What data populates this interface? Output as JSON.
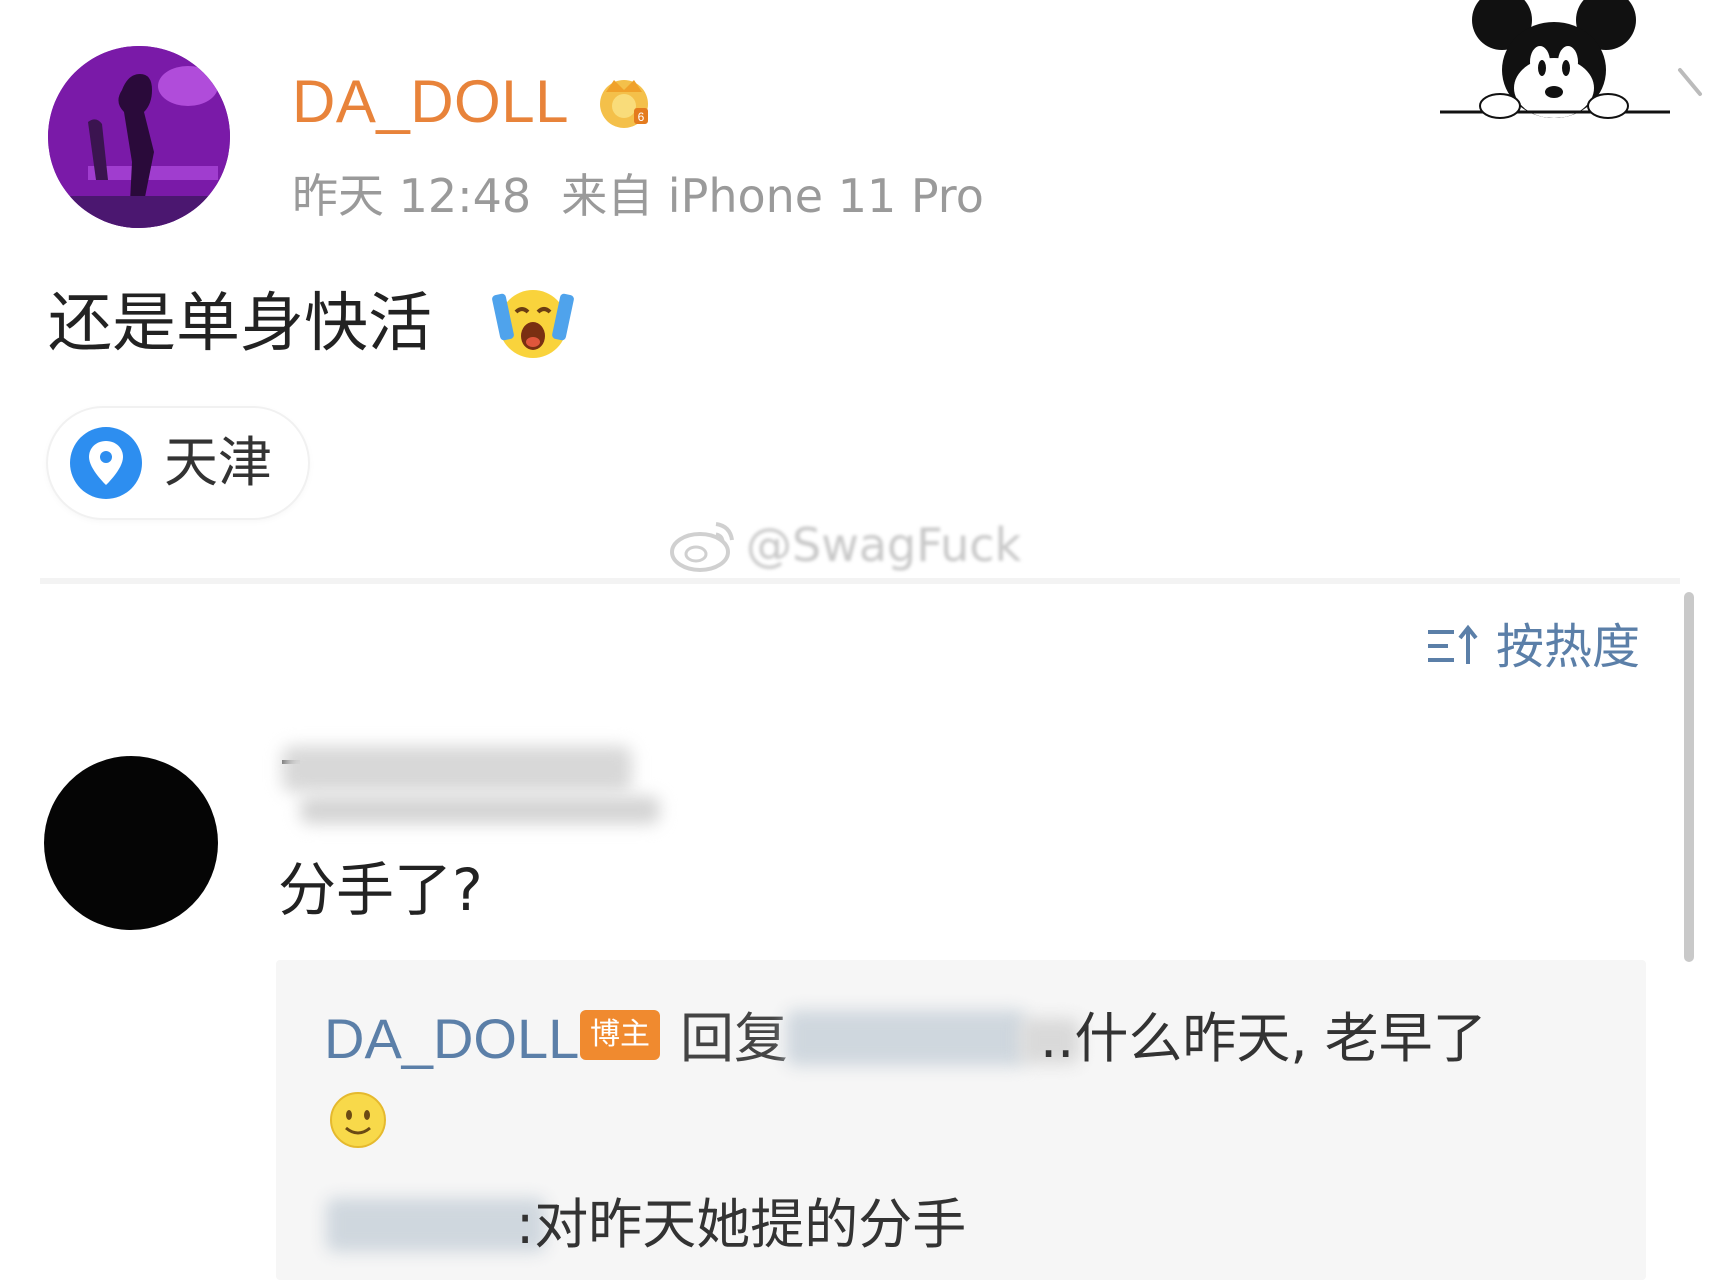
{
  "post": {
    "username": "DA_DOLL",
    "time": "昨天 12:48",
    "source": "来自 iPhone 11 Pro",
    "text": "还是单身快活",
    "location": "天津"
  },
  "watermark": {
    "text": "@SwagFuck"
  },
  "comments": {
    "sort_label": "按热度",
    "items": [
      {
        "text": "分手了?",
        "reply": {
          "author": "DA_DOLL",
          "badge": "博主",
          "verb": "回复",
          "text_1": "..什么昨天, 老早了",
          "text_2": ":对昨天她提的分手"
        }
      }
    ]
  },
  "colors": {
    "username": "#e8833a",
    "link_blue": "#5b7fa8",
    "meta_gray": "#9a9a9a",
    "op_badge": "#f08a2f"
  },
  "icons": {
    "avatar": "avatar-image",
    "crown": "crown-badge-icon",
    "mascot": "mickey-mouse-icon",
    "emoji_post": "crying-emoji-icon",
    "location": "location-pin-icon",
    "sort": "sort-icon",
    "emoji_reply": "smile-emoji-icon"
  }
}
